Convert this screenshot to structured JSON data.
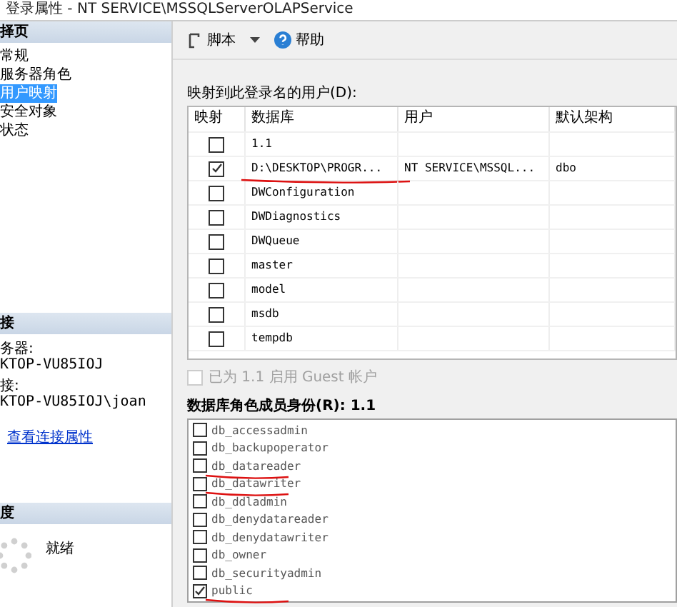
{
  "window": {
    "title": "登录属性 - NT SERVICE\\MSSQLServerOLAPService"
  },
  "sidebar": {
    "header": "择页",
    "items": [
      {
        "label": "常规",
        "selected": false
      },
      {
        "label": "服务器角色",
        "selected": false
      },
      {
        "label": "用户映射",
        "selected": true
      },
      {
        "label": "安全对象",
        "selected": false
      },
      {
        "label": "状态",
        "selected": false
      }
    ]
  },
  "connection": {
    "header": "接",
    "server_label": "务器:",
    "server": "KTOP-VU85IOJ",
    "connection_label": "接:",
    "connection": "KTOP-VU85IOJ\\joan",
    "link": "查看连接属性"
  },
  "progress": {
    "header": "度",
    "status": "就绪"
  },
  "toolbar": [
    {
      "label": "脚本",
      "kind": "script"
    },
    {
      "label": "帮助",
      "kind": "help"
    }
  ],
  "users": {
    "label": "映射到此登录名的用户(D):",
    "columns": [
      "映射",
      "数据库",
      "用户",
      "默认架构"
    ],
    "rows": [
      {
        "mapped": false,
        "database": "1.1",
        "underlined": false
      },
      {
        "mapped": true,
        "database": "D:\\DESKTOP\\PROGR...",
        "user": "NT SERVICE\\MSSQL...",
        "schema": "dbo",
        "underlined": true
      },
      {
        "mapped": false,
        "database": "DWConfiguration",
        "underlined": false
      },
      {
        "mapped": false,
        "database": "DWDiagnostics",
        "underlined": false
      },
      {
        "mapped": false,
        "database": "DWQueue",
        "underlined": false
      },
      {
        "mapped": false,
        "database": "master",
        "underlined": false
      },
      {
        "mapped": false,
        "database": "model",
        "underlined": false
      },
      {
        "mapped": false,
        "database": "msdb",
        "underlined": false
      },
      {
        "mapped": false,
        "database": "tempdb",
        "underlined": false
      }
    ]
  },
  "guest": {
    "label": "已为 1.1 启用 Guest 帐户",
    "checked": false,
    "disabled": true
  },
  "roles": {
    "label": "数据库角色成员身份(R): 1.1",
    "items": [
      {
        "name": "db_accessadmin",
        "checked": false,
        "underlined": false
      },
      {
        "name": "db_backupoperator",
        "checked": false,
        "underlined": false
      },
      {
        "name": "db_datareader",
        "checked": false,
        "underlined": true
      },
      {
        "name": "db_datawriter",
        "checked": false,
        "underlined": true
      },
      {
        "name": "db_ddladmin",
        "checked": false,
        "underlined": false
      },
      {
        "name": "db_denydatareader",
        "checked": false,
        "underlined": false
      },
      {
        "name": "db_denydatawriter",
        "checked": false,
        "underlined": false
      },
      {
        "name": "db_owner",
        "checked": false,
        "underlined": false
      },
      {
        "name": "db_securityadmin",
        "checked": false,
        "underlined": false
      },
      {
        "name": "public",
        "checked": true,
        "underlined": true
      }
    ]
  }
}
